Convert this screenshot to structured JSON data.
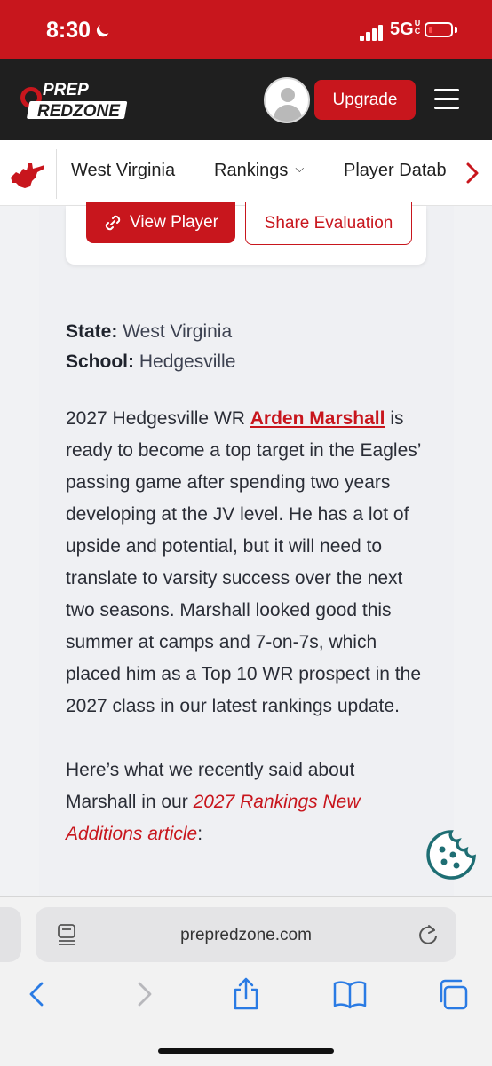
{
  "status_bar": {
    "time": "8:30",
    "network": "5G",
    "network_sub": "UC"
  },
  "header": {
    "logo_top": "PREP",
    "logo_bottom": "REDZONE",
    "upgrade_label": "Upgrade"
  },
  "subnav": {
    "items": [
      "West Virginia",
      "Rankings",
      "Player Datab"
    ],
    "rankings_caret": "⌄"
  },
  "actions": {
    "view_player": "View Player",
    "share_evaluation": "Share Evaluation"
  },
  "meta": {
    "state_label": "State:",
    "state_value": "West Virginia",
    "school_label": "School:",
    "school_value": "Hedgesville"
  },
  "article": {
    "p1_before": "2027 Hedgesville WR ",
    "p1_link": "Arden Marshall",
    "p1_after": " is ready to become a top target in the Eagles’ passing game after spending two years developing at the JV level. He has a lot of upside and potential, but it will need to translate to varsity success over the next two seasons. Marshall looked good this summer at camps and 7-on-7s, which placed him as a Top 10 WR prospect in the 2027 class in our latest rankings update.",
    "p2_before": "Here’s what we recently said about Marshall in our ",
    "p2_link": "2027 Rankings New Additions article",
    "p2_after": ":"
  },
  "browser": {
    "url": "prepredzone.com"
  },
  "colors": {
    "brand_red": "#c8161d",
    "header_dark": "#1f1f1f",
    "cookie_teal": "#1e6e73"
  }
}
